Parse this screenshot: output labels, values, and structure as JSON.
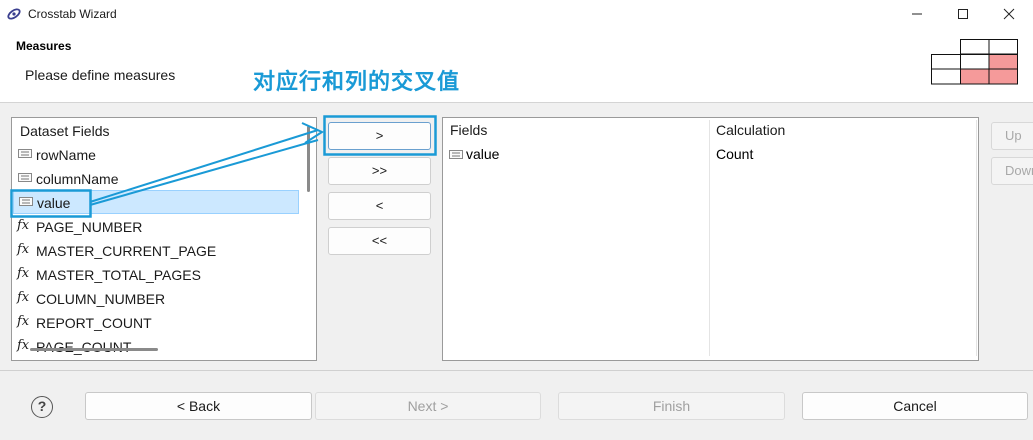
{
  "window": {
    "title": "Crosstab Wizard",
    "controls": [
      "minimize-icon",
      "maximize-icon",
      "close-icon"
    ]
  },
  "header": {
    "title": "Measures",
    "description": "Please define measures",
    "annotation": "对应行和列的交叉值",
    "annotation_color": "#1a9ad6",
    "preview_highlight_color": "#f59a9a"
  },
  "dataset_fields": {
    "header": "Dataset Fields",
    "items": [
      {
        "label": "rowName",
        "icon": "field-icon"
      },
      {
        "label": "columnName",
        "icon": "field-icon"
      },
      {
        "label": "value",
        "icon": "field-icon",
        "selected": true
      },
      {
        "label": "PAGE_NUMBER",
        "icon": "function-icon"
      },
      {
        "label": "MASTER_CURRENT_PAGE",
        "icon": "function-icon"
      },
      {
        "label": "MASTER_TOTAL_PAGES",
        "icon": "function-icon"
      },
      {
        "label": "COLUMN_NUMBER",
        "icon": "function-icon"
      },
      {
        "label": "REPORT_COUNT",
        "icon": "function-icon"
      },
      {
        "label": "PAGE_COUNT",
        "icon": "function-icon"
      }
    ],
    "fx_glyph": "fx"
  },
  "transfer_buttons": {
    "add": ">",
    "add_all": ">>",
    "remove": "<",
    "remove_all": "<<"
  },
  "measures_table": {
    "columns": [
      "Fields",
      "Calculation"
    ],
    "rows": [
      {
        "field": "value",
        "calculation": "Count"
      }
    ]
  },
  "side_buttons": {
    "up": "Up",
    "down": "Down"
  },
  "footer": {
    "help": "?",
    "back": "< Back",
    "next": "Next >",
    "finish": "Finish",
    "cancel": "Cancel"
  },
  "accent_color": "#1a9ad6",
  "selection_color": "#cce8ff"
}
